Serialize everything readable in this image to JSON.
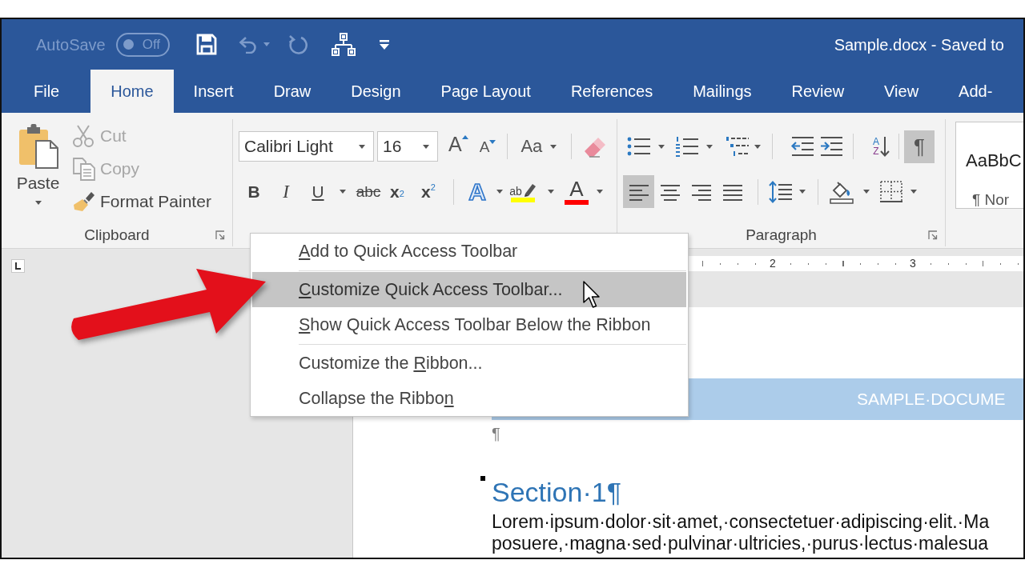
{
  "title_bar": {
    "autosave": {
      "label": "AutoSave",
      "switch_text": "Off",
      "on": false,
      "disabled": true
    },
    "quick_access": [
      {
        "kind": "save",
        "disabled": false
      },
      {
        "kind": "undo",
        "disabled": true
      },
      {
        "kind": "redo",
        "disabled": true
      },
      {
        "kind": "hierarchy",
        "disabled": false
      },
      {
        "kind": "customize",
        "disabled": false
      }
    ],
    "title": "Sample.docx - Saved to"
  },
  "tabs": [
    {
      "label": "File",
      "selected": false
    },
    {
      "label": "Home",
      "selected": true
    },
    {
      "label": "Insert",
      "selected": false
    },
    {
      "label": "Draw",
      "selected": false
    },
    {
      "label": "Design",
      "selected": false
    },
    {
      "label": "Page Layout",
      "selected": false
    },
    {
      "label": "References",
      "selected": false
    },
    {
      "label": "Mailings",
      "selected": false
    },
    {
      "label": "Review",
      "selected": false
    },
    {
      "label": "View",
      "selected": false
    },
    {
      "label": "Add-",
      "selected": false
    }
  ],
  "ribbon": {
    "clipboard": {
      "paste": "Paste",
      "commands": [
        {
          "kind": "cut",
          "label": "Cut",
          "disabled": true
        },
        {
          "kind": "copy",
          "label": "Copy",
          "disabled": true
        },
        {
          "kind": "painter",
          "label": "Format Painter",
          "disabled": false
        }
      ],
      "label": "Clipboard"
    },
    "font": {
      "font_name": "Calibri Light",
      "font_size": "16",
      "size_buttons": [
        {
          "kind": "grow",
          "label": "A"
        },
        {
          "kind": "shrink",
          "label": "A"
        }
      ],
      "change_case": "Aa",
      "format_buttons": [
        {
          "kind": "bold",
          "label": "B"
        },
        {
          "kind": "italic",
          "label": "I"
        },
        {
          "kind": "underline",
          "label": "U"
        },
        {
          "kind": "strike",
          "label": "abc"
        },
        {
          "kind": "subscript",
          "label": "x$_{2}$"
        },
        {
          "kind": "superscript",
          "label": "x$^{2}$"
        }
      ],
      "color_buttons": [
        {
          "kind": "effects",
          "label": "A"
        },
        {
          "kind": "highlight",
          "label": "ab",
          "color": "#ffff00"
        },
        {
          "kind": "font_color",
          "label": "A",
          "color": "#ff0000"
        }
      ]
    },
    "paragraph": {
      "sort": {
        "upper": "A",
        "lower": "Z"
      },
      "marks": {
        "label": "¶",
        "selected": true
      },
      "alignment": [
        {
          "kind": "left",
          "selected": true
        },
        {
          "kind": "center",
          "selected": false
        },
        {
          "kind": "right",
          "selected": false
        },
        {
          "kind": "justify",
          "selected": false
        }
      ],
      "label": "Paragraph"
    },
    "styles": {
      "sample": "AaBbC",
      "name": "¶ Nor"
    }
  },
  "ruler": {
    "numbers": [
      "2",
      "3"
    ]
  },
  "document": {
    "title_band": "SAMPLE·DOCUME",
    "empty_paragraph": "¶",
    "heading": "Section·1¶",
    "body_lines": [
      "Lorem·ipsum·dolor·sit·amet,·consectetuer·adipiscing·elit.·Ma",
      "posuere,·magna·sed·pulvinar·ultricies,·purus·lectus·malesua"
    ]
  },
  "context_menu": {
    "groups": [
      [
        {
          "key": "A",
          "after": "dd to Quick Access Toolbar",
          "selected": false
        }
      ],
      [
        {
          "key": "C",
          "after": "ustomize Quick Access Toolbar...",
          "selected": true
        },
        {
          "key": "S",
          "after": "how Quick Access Toolbar Below the Ribbon",
          "selected": false
        }
      ],
      [
        {
          "before": "Customize the ",
          "key": "R",
          "after": "ibbon...",
          "selected": false
        },
        {
          "before": "Collapse the Ribbo",
          "key": "n",
          "selected": false
        }
      ]
    ]
  }
}
